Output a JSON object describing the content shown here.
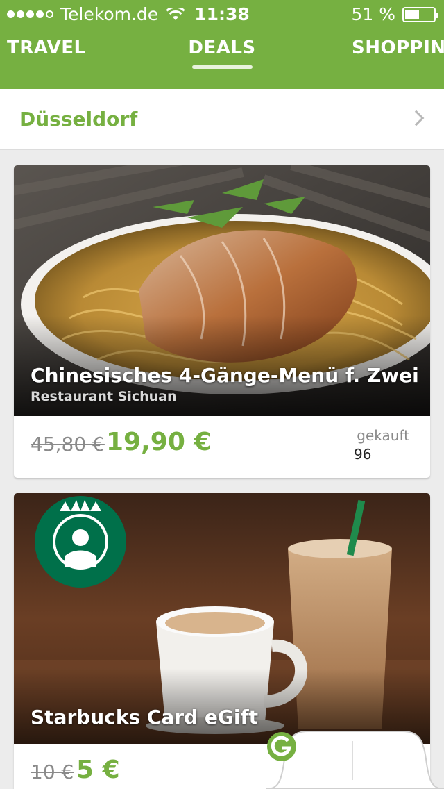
{
  "status_bar": {
    "carrier": "Telekom.de",
    "time": "11:38",
    "battery_text": "51 %",
    "battery_level": 0.51
  },
  "tabs": [
    {
      "label": "TRAVEL"
    },
    {
      "label": "DEALS",
      "active": true
    },
    {
      "label": "SHOPPING"
    }
  ],
  "city": {
    "name": "Düsseldorf"
  },
  "deals": [
    {
      "title": "Chinesisches 4-Gänge-Menü f. Zwei",
      "merchant": "Restaurant Sichuan",
      "old_price": "45,80 €",
      "new_price": "19,90 €",
      "sold_label": "gekauft",
      "sold_count": "96"
    },
    {
      "title": "Starbucks Card eGift",
      "old_price": "10 €",
      "new_price": "5 €"
    }
  ],
  "colors": {
    "brand_green": "#76b041",
    "starbucks_green": "#00704a"
  },
  "icons": {
    "bell": "bell-icon",
    "logo": "g-logo-icon",
    "chevron": "chevron-right-icon"
  }
}
